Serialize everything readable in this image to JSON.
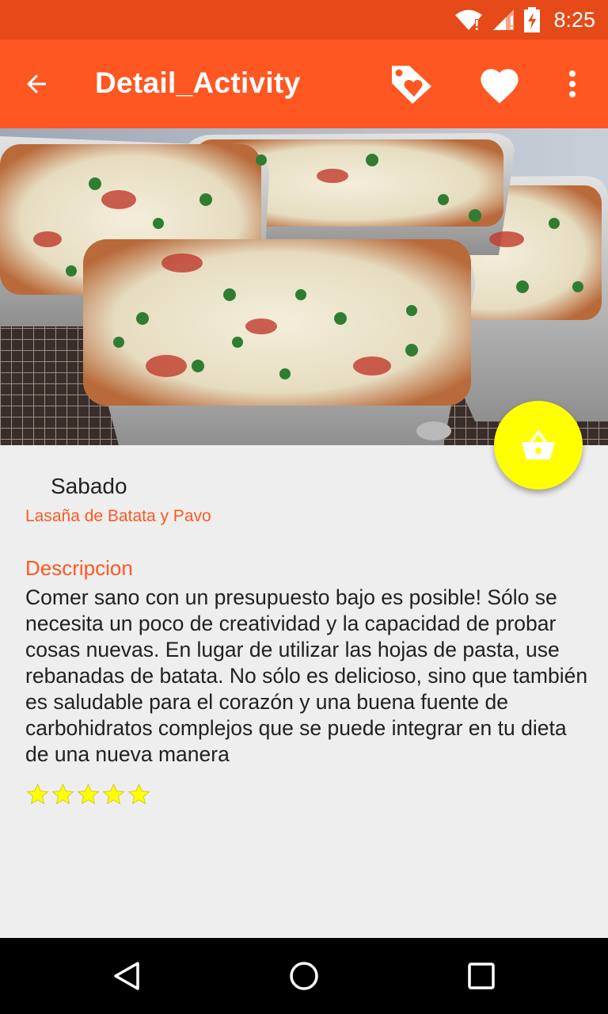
{
  "status_bar": {
    "time": "8:25"
  },
  "app_bar": {
    "title": "Detail_Activity",
    "icons": [
      "arrow-back-icon",
      "tag-heart-icon",
      "heart-icon",
      "more-vert-icon"
    ]
  },
  "recipe": {
    "day": "Sabado",
    "name": "Lasaña de Batata y Pavo",
    "description_heading": "Descripcion",
    "description": "Comer sano con un presupuesto bajo es posible! Sólo se necesita un poco de creatividad y la capacidad de probar cosas nuevas. En lugar de utilizar las hojas de pasta, use rebanadas de batata. No sólo es delicioso, sino que también es saludable para el corazón y una buena fuente de carbohidratos complejos que se puede integrar en tu dieta de una nueva manera",
    "rating": 5,
    "rating_max": 5
  },
  "fab": {
    "icon": "basket-icon"
  },
  "colors": {
    "primary": "#FF5722",
    "primary_dark": "#E64A19",
    "fab": "#FFFF00",
    "star": "#FFFF00",
    "background": "#EEEEEE"
  }
}
